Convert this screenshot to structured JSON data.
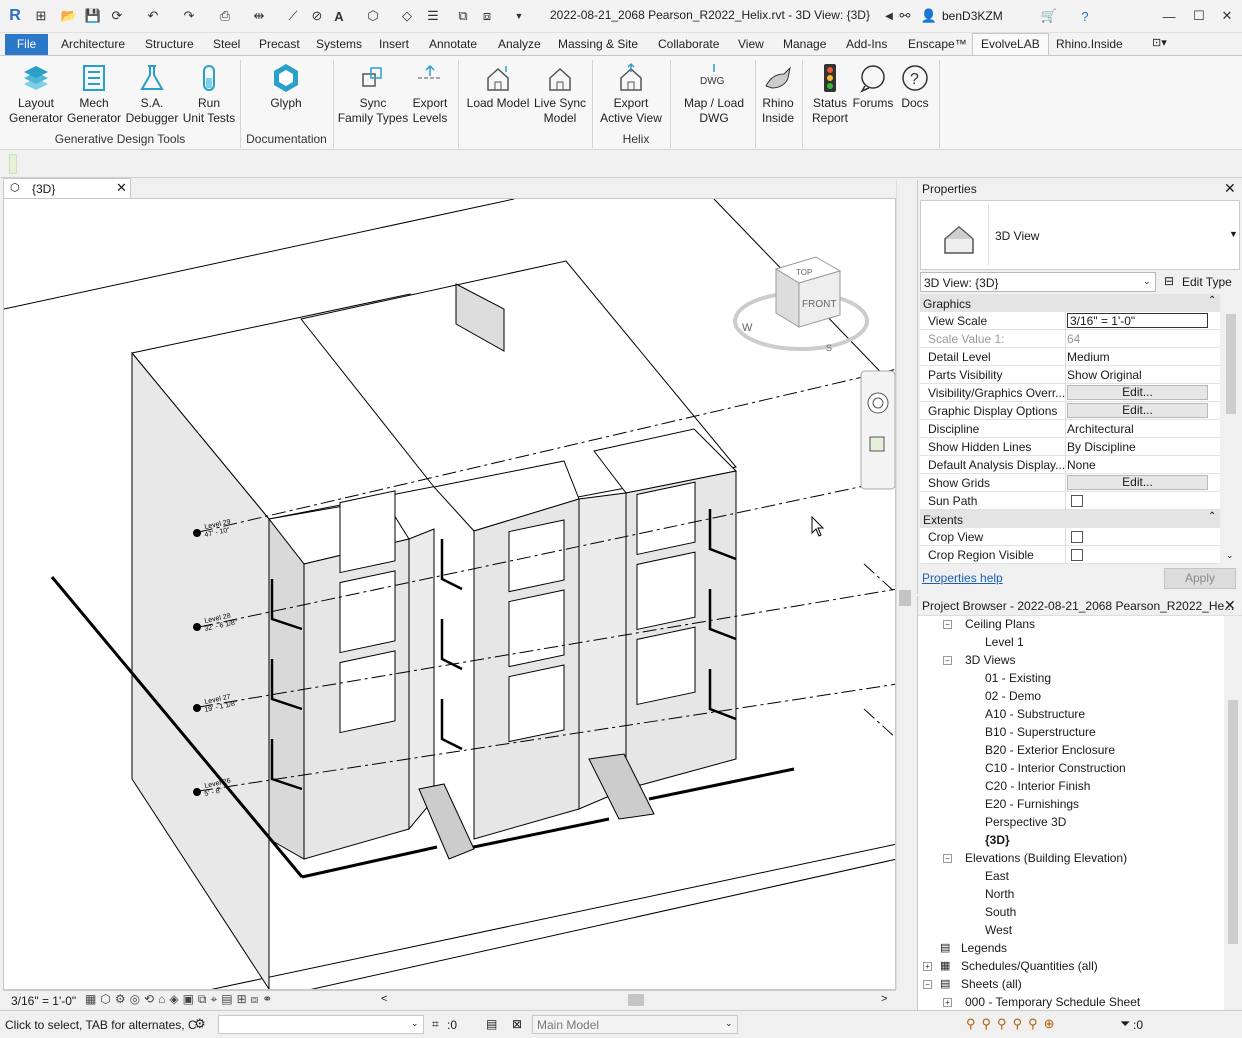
{
  "window": {
    "title": "2022-08-21_2068 Pearson_R2022_Helix.rvt - 3D View: {3D}",
    "user": "benD3KZM"
  },
  "menu": {
    "file": "File",
    "tabs": [
      "Architecture",
      "Structure",
      "Steel",
      "Precast",
      "Systems",
      "Insert",
      "Annotate",
      "Analyze",
      "Massing & Site",
      "Collaborate",
      "View",
      "Manage",
      "Add-Ins",
      "Enscape™",
      "EvolveLAB",
      "Rhino.Inside"
    ],
    "active": "EvolveLAB"
  },
  "ribbon": {
    "buttons": [
      {
        "label": "Layout\nGenerator",
        "icon": "layout-generator-icon"
      },
      {
        "label": "Mech\nGenerator",
        "icon": "mech-generator-icon"
      },
      {
        "label": "S.A.\nDebugger",
        "icon": "flask-icon"
      },
      {
        "label": "Run\nUnit Tests",
        "icon": "test-tube-icon"
      },
      {
        "label": "Glyph",
        "icon": "glyph-logo-icon"
      },
      {
        "label": "Sync\nFamily Types",
        "icon": "sync-icon"
      },
      {
        "label": "Export\nLevels",
        "icon": "export-levels-icon"
      },
      {
        "label": "Load Model",
        "icon": "load-model-icon"
      },
      {
        "label": "Live Sync\nModel",
        "icon": "live-sync-icon"
      },
      {
        "label": "Export\nActive View",
        "icon": "export-view-icon"
      },
      {
        "label": "Map / Load\nDWG",
        "icon": "dwg-icon"
      },
      {
        "label": "Rhino\nInside",
        "icon": "rhino-icon"
      },
      {
        "label": "Status\nReport",
        "icon": "traffic-light-icon"
      },
      {
        "label": "Forums",
        "icon": "chat-icon"
      },
      {
        "label": "Docs",
        "icon": "question-icon"
      }
    ],
    "groups": [
      "Generative Design Tools",
      "Documentation",
      "Helix"
    ]
  },
  "view": {
    "tab_label": "{3D}",
    "scale": "3/16\" = 1'-0\"",
    "levels": [
      {
        "name": "Level 29",
        "elev": "47' - 10\""
      },
      {
        "name": "Level 28",
        "elev": "32' - 6 1/8\""
      },
      {
        "name": "Level 27",
        "elev": "19' - 1 1/8\""
      },
      {
        "name": "Level 26",
        "elev": "5' - 8\""
      }
    ],
    "viewcube": {
      "top": "TOP",
      "front": "FRONT",
      "w": "W",
      "s": "S"
    }
  },
  "properties": {
    "title": "Properties",
    "type": "3D View",
    "instance": "3D View: {3D}",
    "edit_type": "Edit Type",
    "section_graphics": "Graphics",
    "section_extents": "Extents",
    "rows": [
      {
        "name": "View Scale",
        "value": "3/16\" = 1'-0\""
      },
      {
        "name": "Scale Value   1:",
        "value": "64"
      },
      {
        "name": "Detail Level",
        "value": "Medium"
      },
      {
        "name": "Parts Visibility",
        "value": "Show Original"
      },
      {
        "name": "Visibility/Graphics Overr...",
        "value": "Edit..."
      },
      {
        "name": "Graphic Display Options",
        "value": "Edit..."
      },
      {
        "name": "Discipline",
        "value": "Architectural"
      },
      {
        "name": "Show Hidden Lines",
        "value": "By Discipline"
      },
      {
        "name": "Default Analysis Display...",
        "value": "None"
      },
      {
        "name": "Show Grids",
        "value": "Edit..."
      },
      {
        "name": "Sun Path",
        "value": ""
      }
    ],
    "extents": [
      {
        "name": "Crop View"
      },
      {
        "name": "Crop Region Visible"
      }
    ],
    "help": "Properties help",
    "apply": "Apply"
  },
  "browser": {
    "title": "Project Browser - 2022-08-21_2068 Pearson_R2022_He...",
    "ceiling_plans": "Ceiling Plans",
    "level1": "Level 1",
    "views3d": "3D Views",
    "views": [
      "01 - Existing",
      "02 - Demo",
      "A10 - Substructure",
      "B10 - Superstructure",
      "B20 - Exterior Enclosure",
      "C10 - Interior Construction",
      "C20 - Interior Finish",
      "E20 - Furnishings",
      "Perspective 3D",
      "{3D}"
    ],
    "elevations": "Elevations (Building Elevation)",
    "elev_items": [
      "East",
      "North",
      "South",
      "West"
    ],
    "legends": "Legends",
    "schedules": "Schedules/Quantities (all)",
    "sheets": "Sheets (all)",
    "sheet0": "000 - Temporary Schedule Sheet"
  },
  "status": {
    "hint": "Click to select, TAB for alternates, C",
    "filter_count": ":0",
    "model": "Main Model",
    "sel_count": ":0"
  }
}
